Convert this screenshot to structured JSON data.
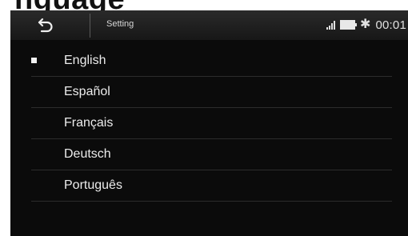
{
  "page": {
    "heading": "nguage"
  },
  "header": {
    "title": "Setting",
    "clock": "00:01"
  },
  "icons": {
    "back": "back-arrow-icon",
    "signal": "signal-icon",
    "battery": "battery-icon",
    "bluetooth": "bluetooth-icon"
  },
  "languages": [
    {
      "label": "English",
      "selected": true
    },
    {
      "label": "Español",
      "selected": false
    },
    {
      "label": "Français",
      "selected": false
    },
    {
      "label": "Deutsch",
      "selected": false
    },
    {
      "label": "Português",
      "selected": false
    }
  ],
  "colors": {
    "background": "#0b0b0b",
    "text": "#ececec",
    "bar": "#1f1f1f"
  }
}
